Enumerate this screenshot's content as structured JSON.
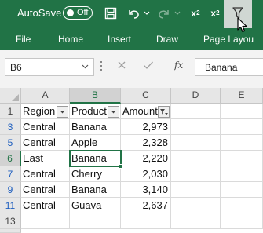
{
  "titlebar": {
    "autosave_label": "AutoSave",
    "autosave_state": "Off",
    "subscript_label": "x",
    "subscript_mark": "2",
    "superscript_label": "x",
    "superscript_mark": "2",
    "bg_color": "#217346"
  },
  "ribbon_tabs": [
    "File",
    "Home",
    "Insert",
    "Draw",
    "Page Layou"
  ],
  "formula_bar": {
    "name_box": "B6",
    "fx_label": "fx",
    "value": "Banana"
  },
  "grid": {
    "columns": [
      "A",
      "B",
      "C",
      "D",
      "E"
    ],
    "selected_column": "B",
    "header_row": {
      "row_number": "1",
      "cells": [
        "Region",
        "Product",
        "Amount"
      ],
      "filter_icons": [
        "dropdown-icon",
        "dropdown-icon",
        "filtered-dropdown-icon"
      ]
    },
    "rows": [
      {
        "row_number": "3",
        "region": "Central",
        "product": "Banana",
        "amount": "2,973"
      },
      {
        "row_number": "5",
        "region": "Central",
        "product": "Apple",
        "amount": "2,328"
      },
      {
        "row_number": "6",
        "region": "East",
        "product": "Banana",
        "amount": "2,220"
      },
      {
        "row_number": "7",
        "region": "Central",
        "product": "Cherry",
        "amount": "2,030"
      },
      {
        "row_number": "9",
        "region": "Central",
        "product": "Banana",
        "amount": "3,140"
      },
      {
        "row_number": "11",
        "region": "Central",
        "product": "Guava",
        "amount": "2,637"
      }
    ],
    "empty_rows": [
      "13",
      "14"
    ],
    "active_cell": "B6"
  }
}
